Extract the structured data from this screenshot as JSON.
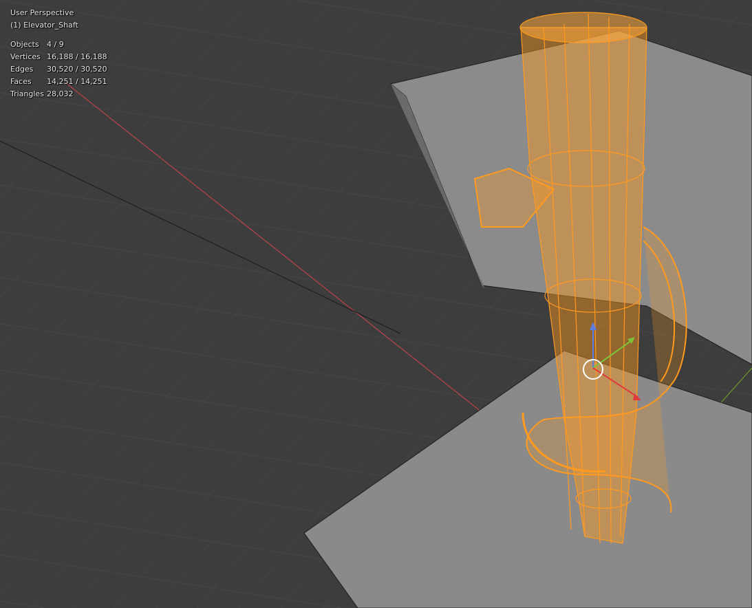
{
  "viewport": {
    "view_name": "User Perspective",
    "active_object": "(1) Elevator_Shaft",
    "stats": [
      {
        "label": "Objects",
        "value": "4 / 9"
      },
      {
        "label": "Vertices",
        "value": "16,188 / 16,188"
      },
      {
        "label": "Edges",
        "value": "30,520 / 30,520"
      },
      {
        "label": "Faces",
        "value": "14,251 / 14,251"
      },
      {
        "label": "Triangles",
        "value": "28,032"
      }
    ],
    "colors": {
      "background": "#3d3d3d",
      "grid": "#4a4a4a",
      "selection": "#ff9a1f",
      "x_axis": "#b4434a",
      "y_axis": "#6c9b2a",
      "floor": "#8a8a8a"
    },
    "gizmo_icons": [
      "z-arrow-icon",
      "y-arrow-icon",
      "x-arrow-icon",
      "3d-cursor-icon"
    ]
  }
}
